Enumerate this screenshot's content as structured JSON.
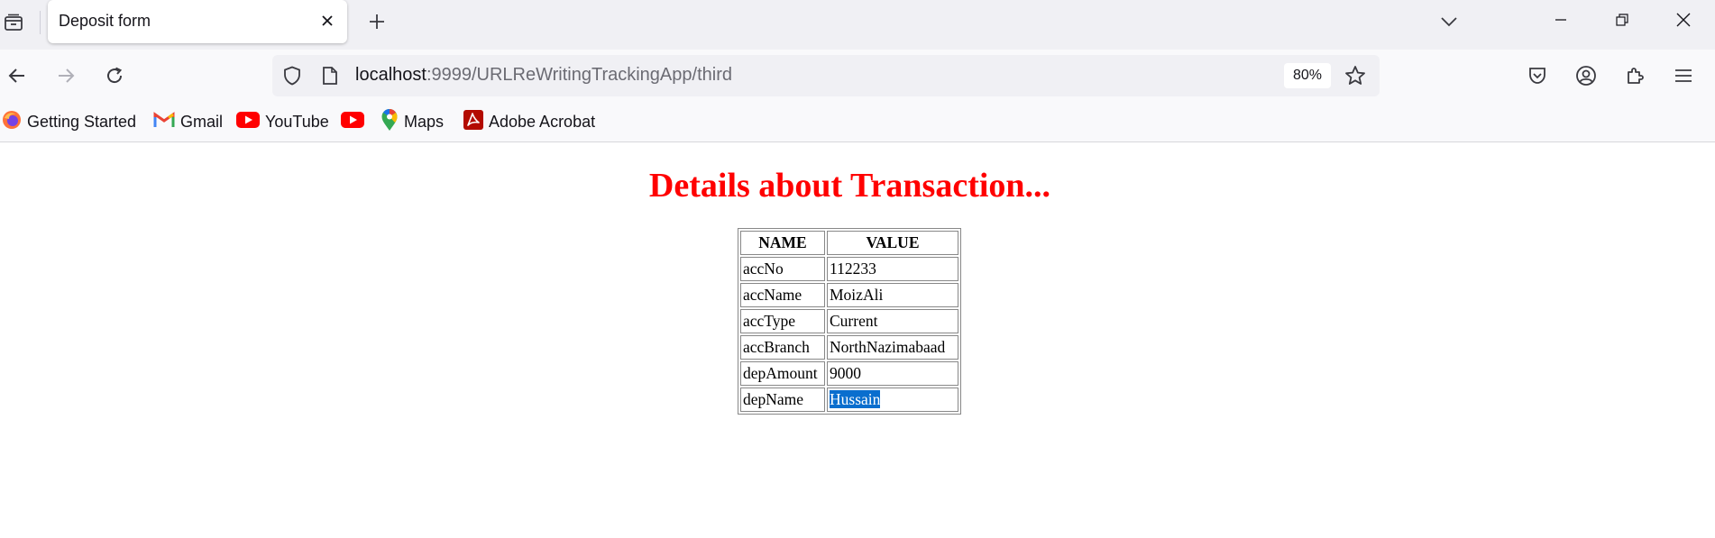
{
  "browser": {
    "tab": {
      "title": "Deposit form"
    },
    "url": {
      "host": "localhost",
      "rest": ":9999/URLReWritingTrackingApp/third"
    },
    "zoom": "80%",
    "bookmarks": [
      {
        "label": "Getting Started",
        "icon": "firefox-icon"
      },
      {
        "label": "Gmail",
        "icon": "gmail-icon"
      },
      {
        "label": "YouTube",
        "icon": "youtube-icon"
      },
      {
        "label": "",
        "icon": "youtube-icon"
      },
      {
        "label": "Maps",
        "icon": "maps-pin-icon"
      },
      {
        "label": "Adobe Acrobat",
        "icon": "adobe-acrobat-icon"
      }
    ]
  },
  "page": {
    "heading": "Details about Transaction...",
    "table": {
      "headers": [
        "NAME",
        "VALUE"
      ],
      "rows": [
        [
          "accNo",
          "112233"
        ],
        [
          "accName",
          "MoizAli"
        ],
        [
          "accType",
          "Current"
        ],
        [
          "accBranch",
          "NorthNazimabaad"
        ],
        [
          "depAmount",
          "9000"
        ],
        [
          "depName",
          "Hussain"
        ]
      ],
      "selected_cell": "Hussain"
    }
  },
  "colors": {
    "heading": "#ff0000",
    "selection": "#0a6ece"
  }
}
